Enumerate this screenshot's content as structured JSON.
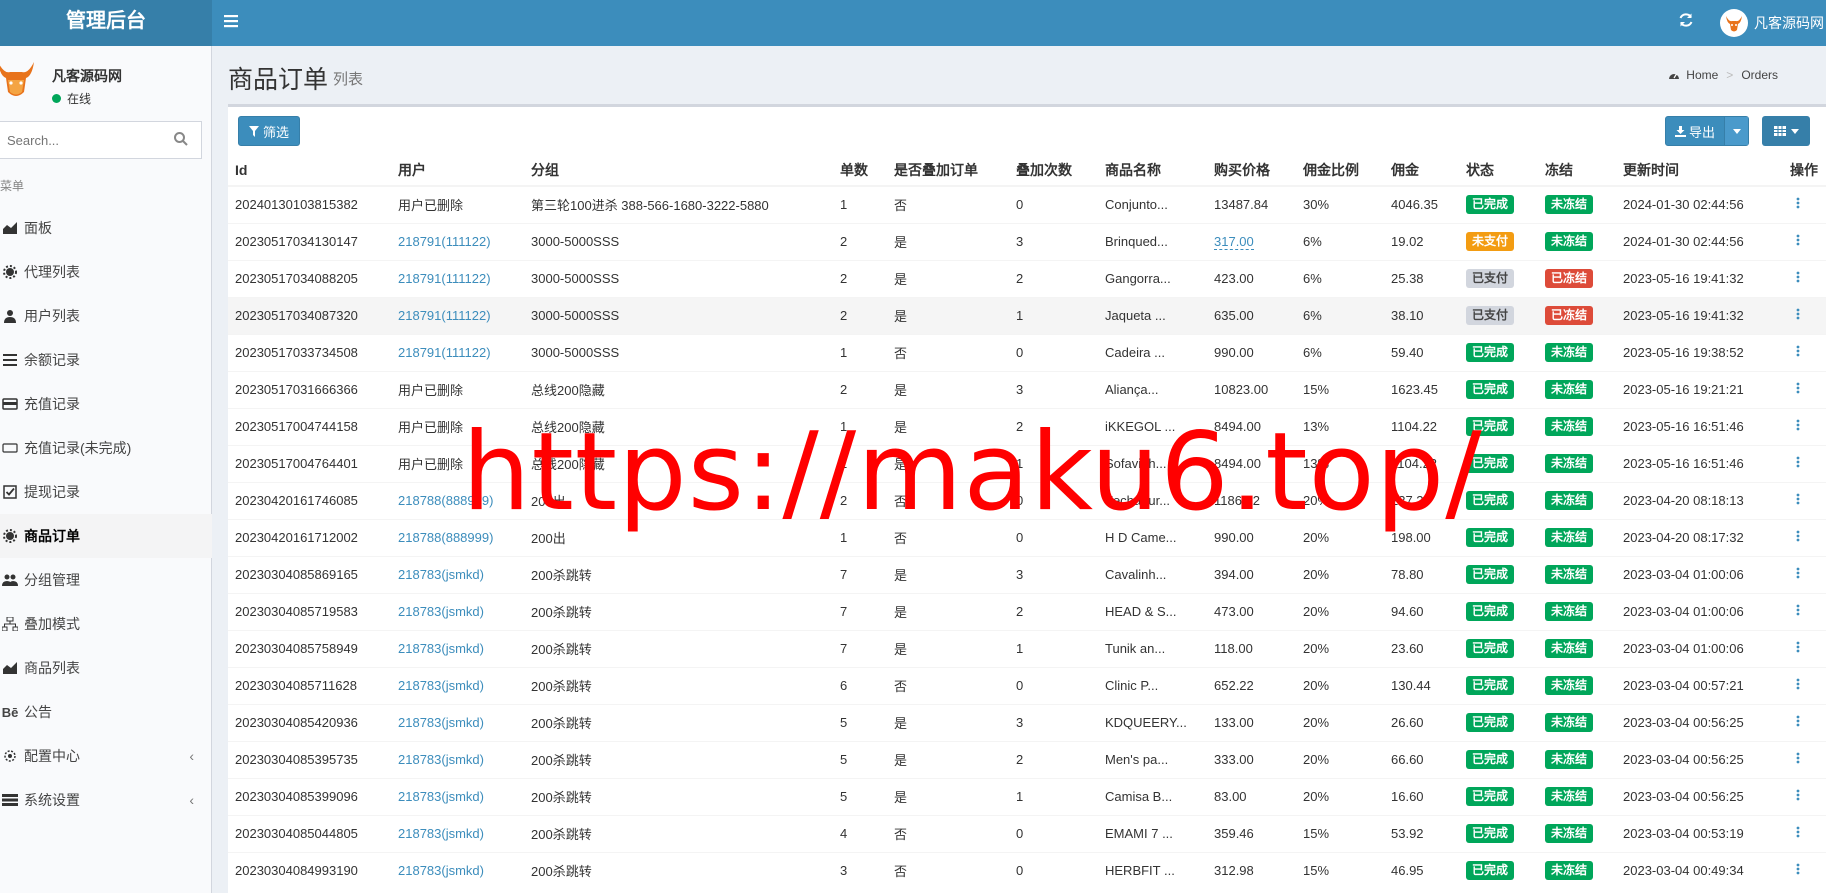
{
  "app": {
    "brand": "管理后台",
    "user_name": "凡客源码网"
  },
  "sidebar": {
    "user_name": "凡客源码网",
    "status": "在线",
    "search_placeholder": "Search...",
    "menu_header": "菜单",
    "items": [
      {
        "label": "面板",
        "icon": "dashboard-icon"
      },
      {
        "label": "代理列表",
        "icon": "gear-icon"
      },
      {
        "label": "用户列表",
        "icon": "user-icon"
      },
      {
        "label": "余额记录",
        "icon": "list-icon"
      },
      {
        "label": "充值记录",
        "icon": "card-icon"
      },
      {
        "label": "充值记录(未完成)",
        "icon": "card-outline-icon"
      },
      {
        "label": "提现记录",
        "icon": "checkbox-icon"
      },
      {
        "label": "商品订单",
        "icon": "gear-icon",
        "active": true
      },
      {
        "label": "分组管理",
        "icon": "users-icon"
      },
      {
        "label": "叠加模式",
        "icon": "sitemap-icon"
      },
      {
        "label": "商品列表",
        "icon": "chart-icon"
      },
      {
        "label": "公告",
        "icon": "behance-icon"
      },
      {
        "label": "配置中心",
        "icon": "cogs-icon",
        "has_children": true
      },
      {
        "label": "系统设置",
        "icon": "server-icon",
        "has_children": true
      }
    ]
  },
  "page": {
    "title": "商品订单",
    "subtitle": "列表",
    "breadcrumb": [
      "Home",
      "Orders"
    ]
  },
  "toolbar": {
    "filter_label": "筛选",
    "export_label": "导出"
  },
  "table": {
    "columns": [
      "Id",
      "用户",
      "分组",
      "单数",
      "是否叠加订单",
      "叠加次数",
      "商品名称",
      "购买价格",
      "佣金比例",
      "佣金",
      "状态",
      "冻结",
      "更新时间",
      "操作"
    ],
    "rows": [
      {
        "id": "20240130103815382",
        "user": "用户已删除",
        "user_link": false,
        "group": "第三轮100进杀 388-566-1680-3222-5880",
        "count": "1",
        "stack": "否",
        "stack_times": "0",
        "product": "Conjunto...",
        "price": "13487.84",
        "price_editable": false,
        "rate": "30%",
        "commission": "4046.35",
        "status": "已完成",
        "status_type": "success",
        "freeze": "未冻结",
        "freeze_type": "success",
        "updated": "2024-01-30 02:44:56"
      },
      {
        "id": "20230517034130147",
        "user": "218791(111122)",
        "user_link": true,
        "group": "3000-5000SSS",
        "count": "2",
        "stack": "是",
        "stack_times": "3",
        "product": "Brinqued...",
        "price": "317.00",
        "price_editable": true,
        "rate": "6%",
        "commission": "19.02",
        "status": "未支付",
        "status_type": "warning",
        "freeze": "未冻结",
        "freeze_type": "success",
        "updated": "2024-01-30 02:44:56"
      },
      {
        "id": "20230517034088205",
        "user": "218791(111122)",
        "user_link": true,
        "group": "3000-5000SSS",
        "count": "2",
        "stack": "是",
        "stack_times": "2",
        "product": "Gangorra...",
        "price": "423.00",
        "price_editable": false,
        "rate": "6%",
        "commission": "25.38",
        "status": "已支付",
        "status_type": "default",
        "freeze": "已冻结",
        "freeze_type": "danger",
        "updated": "2023-05-16 19:41:32"
      },
      {
        "id": "20230517034087320",
        "user": "218791(111122)",
        "user_link": true,
        "group": "3000-5000SSS",
        "count": "2",
        "stack": "是",
        "stack_times": "1",
        "product": "Jaqueta ...",
        "price": "635.00",
        "price_editable": false,
        "rate": "6%",
        "commission": "38.10",
        "status": "已支付",
        "status_type": "default",
        "freeze": "已冻结",
        "freeze_type": "danger",
        "updated": "2023-05-16 19:41:32",
        "highlight": true
      },
      {
        "id": "20230517033734508",
        "user": "218791(111122)",
        "user_link": true,
        "group": "3000-5000SSS",
        "count": "1",
        "stack": "否",
        "stack_times": "0",
        "product": "Cadeira ...",
        "price": "990.00",
        "price_editable": false,
        "rate": "6%",
        "commission": "59.40",
        "status": "已完成",
        "status_type": "success",
        "freeze": "未冻结",
        "freeze_type": "success",
        "updated": "2023-05-16 19:38:52"
      },
      {
        "id": "20230517031666366",
        "user": "用户已删除",
        "user_link": false,
        "group": "总线200隐藏",
        "count": "2",
        "stack": "是",
        "stack_times": "3",
        "product": "Aliança...",
        "price": "10823.00",
        "price_editable": false,
        "rate": "15%",
        "commission": "1623.45",
        "status": "已完成",
        "status_type": "success",
        "freeze": "未冻结",
        "freeze_type": "success",
        "updated": "2023-05-16 19:21:21"
      },
      {
        "id": "20230517004744158",
        "user": "用户已删除",
        "user_link": false,
        "group": "总线200隐藏",
        "count": "1",
        "stack": "是",
        "stack_times": "2",
        "product": "iKKEGOL ...",
        "price": "8494.00",
        "price_editable": false,
        "rate": "13%",
        "commission": "1104.22",
        "status": "已完成",
        "status_type": "success",
        "freeze": "未冻结",
        "freeze_type": "success",
        "updated": "2023-05-16 16:51:46"
      },
      {
        "id": "20230517004764401",
        "user": "用户已删除",
        "user_link": false,
        "group": "总线200隐藏",
        "count": "1",
        "stack": "是",
        "stack_times": "1",
        "product": "Sofavieh...",
        "price": "8494.00",
        "price_editable": false,
        "rate": "13%",
        "commission": "1104.22",
        "status": "已完成",
        "status_type": "success",
        "freeze": "未冻结",
        "freeze_type": "success",
        "updated": "2023-05-16 16:51:46"
      },
      {
        "id": "20230420161746085",
        "user": "218788(888999)",
        "user_link": true,
        "group": "200出",
        "count": "2",
        "stack": "否",
        "stack_times": "0",
        "product": "Fechadur...",
        "price": "1186.02",
        "price_editable": false,
        "rate": "20%",
        "commission": "237.20",
        "status": "已完成",
        "status_type": "success",
        "freeze": "未冻结",
        "freeze_type": "success",
        "updated": "2023-04-20 08:18:13"
      },
      {
        "id": "20230420161712002",
        "user": "218788(888999)",
        "user_link": true,
        "group": "200出",
        "count": "1",
        "stack": "否",
        "stack_times": "0",
        "product": "H D Came...",
        "price": "990.00",
        "price_editable": false,
        "rate": "20%",
        "commission": "198.00",
        "status": "已完成",
        "status_type": "success",
        "freeze": "未冻结",
        "freeze_type": "success",
        "updated": "2023-04-20 08:17:32"
      },
      {
        "id": "20230304085869165",
        "user": "218783(jsmkd)",
        "user_link": true,
        "group": "200杀跳转",
        "count": "7",
        "stack": "是",
        "stack_times": "3",
        "product": "Cavalinh...",
        "price": "394.00",
        "price_editable": false,
        "rate": "20%",
        "commission": "78.80",
        "status": "已完成",
        "status_type": "success",
        "freeze": "未冻结",
        "freeze_type": "success",
        "updated": "2023-03-04 01:00:06"
      },
      {
        "id": "20230304085719583",
        "user": "218783(jsmkd)",
        "user_link": true,
        "group": "200杀跳转",
        "count": "7",
        "stack": "是",
        "stack_times": "2",
        "product": "HEAD & S...",
        "price": "473.00",
        "price_editable": false,
        "rate": "20%",
        "commission": "94.60",
        "status": "已完成",
        "status_type": "success",
        "freeze": "未冻结",
        "freeze_type": "success",
        "updated": "2023-03-04 01:00:06"
      },
      {
        "id": "20230304085758949",
        "user": "218783(jsmkd)",
        "user_link": true,
        "group": "200杀跳转",
        "count": "7",
        "stack": "是",
        "stack_times": "1",
        "product": "Tunik an...",
        "price": "118.00",
        "price_editable": false,
        "rate": "20%",
        "commission": "23.60",
        "status": "已完成",
        "status_type": "success",
        "freeze": "未冻结",
        "freeze_type": "success",
        "updated": "2023-03-04 01:00:06"
      },
      {
        "id": "20230304085711628",
        "user": "218783(jsmkd)",
        "user_link": true,
        "group": "200杀跳转",
        "count": "6",
        "stack": "否",
        "stack_times": "0",
        "product": "Clinic P...",
        "price": "652.22",
        "price_editable": false,
        "rate": "20%",
        "commission": "130.44",
        "status": "已完成",
        "status_type": "success",
        "freeze": "未冻结",
        "freeze_type": "success",
        "updated": "2023-03-04 00:57:21"
      },
      {
        "id": "20230304085420936",
        "user": "218783(jsmkd)",
        "user_link": true,
        "group": "200杀跳转",
        "count": "5",
        "stack": "是",
        "stack_times": "3",
        "product": "KDQUEERY...",
        "price": "133.00",
        "price_editable": false,
        "rate": "20%",
        "commission": "26.60",
        "status": "已完成",
        "status_type": "success",
        "freeze": "未冻结",
        "freeze_type": "success",
        "updated": "2023-03-04 00:56:25"
      },
      {
        "id": "20230304085395735",
        "user": "218783(jsmkd)",
        "user_link": true,
        "group": "200杀跳转",
        "count": "5",
        "stack": "是",
        "stack_times": "2",
        "product": "Men's pa...",
        "price": "333.00",
        "price_editable": false,
        "rate": "20%",
        "commission": "66.60",
        "status": "已完成",
        "status_type": "success",
        "freeze": "未冻结",
        "freeze_type": "success",
        "updated": "2023-03-04 00:56:25"
      },
      {
        "id": "20230304085399096",
        "user": "218783(jsmkd)",
        "user_link": true,
        "group": "200杀跳转",
        "count": "5",
        "stack": "是",
        "stack_times": "1",
        "product": "Camisa B...",
        "price": "83.00",
        "price_editable": false,
        "rate": "20%",
        "commission": "16.60",
        "status": "已完成",
        "status_type": "success",
        "freeze": "未冻结",
        "freeze_type": "success",
        "updated": "2023-03-04 00:56:25"
      },
      {
        "id": "20230304085044805",
        "user": "218783(jsmkd)",
        "user_link": true,
        "group": "200杀跳转",
        "count": "4",
        "stack": "否",
        "stack_times": "0",
        "product": "EMAMI 7 ...",
        "price": "359.46",
        "price_editable": false,
        "rate": "15%",
        "commission": "53.92",
        "status": "已完成",
        "status_type": "success",
        "freeze": "未冻结",
        "freeze_type": "success",
        "updated": "2023-03-04 00:53:19"
      },
      {
        "id": "20230304084993190",
        "user": "218783(jsmkd)",
        "user_link": true,
        "group": "200杀跳转",
        "count": "3",
        "stack": "否",
        "stack_times": "0",
        "product": "HERBFIT ...",
        "price": "312.98",
        "price_editable": false,
        "rate": "15%",
        "commission": "46.95",
        "status": "已完成",
        "status_type": "success",
        "freeze": "未冻结",
        "freeze_type": "success",
        "updated": "2023-03-04 00:49:34"
      }
    ]
  },
  "label_colors": {
    "success": "#00a65a",
    "warning": "#f39c12",
    "danger": "#dd4b39",
    "default": "#d2d6de"
  },
  "watermark": "https://maku6.top/"
}
